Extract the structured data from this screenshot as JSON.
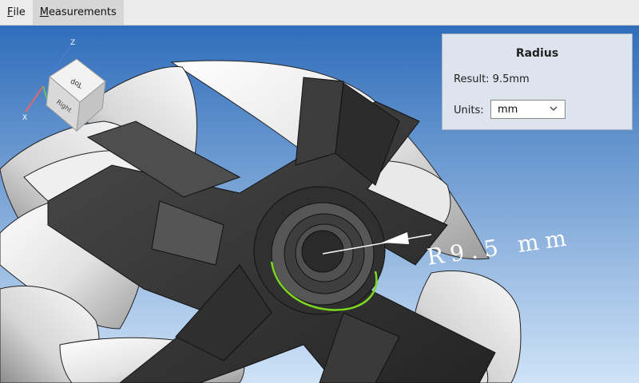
{
  "menubar": {
    "items": [
      {
        "label": "File",
        "mnemonic": "F",
        "rest": "ile"
      },
      {
        "label": "Measurements",
        "mnemonic": "M",
        "rest": "easurements"
      }
    ]
  },
  "viewport": {
    "background_top": "#2f6dba",
    "background_bottom": "#cfe3f7",
    "annotation_text": "R9.5 mm",
    "highlight_color": "#7dd820",
    "nav_cube": {
      "axis_z_label": "Z",
      "axis_x_label": "X",
      "face_top_label": "Top",
      "face_right_label": "Right"
    }
  },
  "panel": {
    "title": "Radius",
    "result_text": "Result: 9.5mm",
    "units_label": "Units:",
    "units_value": "mm"
  }
}
